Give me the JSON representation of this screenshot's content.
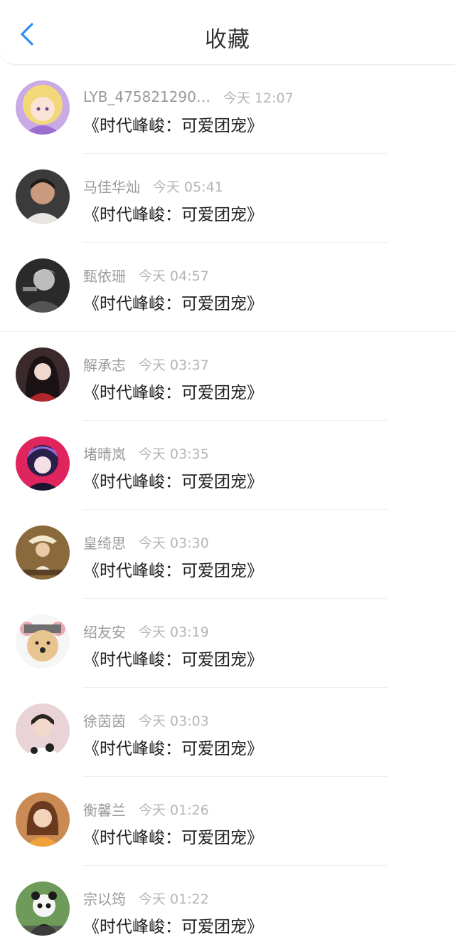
{
  "header": {
    "title": "收藏",
    "back_icon": "chevron-left-icon",
    "accent_color": "#2b8ef0"
  },
  "items": [
    {
      "name": "LYB_475821290…",
      "time": "今天 12:07",
      "content": "《时代峰峻：可爱团宠》"
    },
    {
      "name": "马佳华灿",
      "time": "今天 05:41",
      "content": "《时代峰峻：可爱团宠》"
    },
    {
      "name": "甄依珊",
      "time": "今天 04:57",
      "content": "《时代峰峻：可爱团宠》"
    },
    {
      "name": "解承志",
      "time": "今天 03:37",
      "content": "《时代峰峻：可爱团宠》"
    },
    {
      "name": "堵晴岚",
      "time": "今天 03:35",
      "content": "《时代峰峻：可爱团宠》"
    },
    {
      "name": "皇绮思",
      "time": "今天 03:30",
      "content": "《时代峰峻：可爱团宠》"
    },
    {
      "name": "绍友安",
      "time": "今天 03:19",
      "content": "《时代峰峻：可爱团宠》"
    },
    {
      "name": "徐茵茵",
      "time": "今天 03:03",
      "content": "《时代峰峻：可爱团宠》"
    },
    {
      "name": "衡馨兰",
      "time": "今天 01:26",
      "content": "《时代峰峻：可爱团宠》"
    },
    {
      "name": "宗以筠",
      "time": "今天 01:22",
      "content": "《时代峰峻：可爱团宠》"
    }
  ]
}
